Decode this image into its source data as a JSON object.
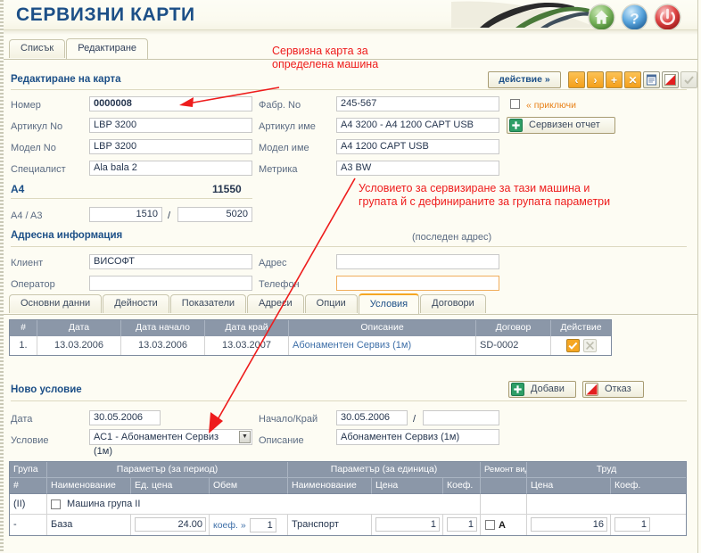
{
  "app": {
    "title": "СЕРВИЗНИ КАРТИ",
    "header_buttons": [
      {
        "name": "home-button",
        "icon": "home-icon",
        "color": "#6aa84f"
      },
      {
        "name": "help-button",
        "icon": "question-mark-icon",
        "color": "#3d85c8"
      },
      {
        "name": "power-button",
        "icon": "power-icon",
        "color": "#cc2b2b"
      }
    ]
  },
  "top_tabs": [
    {
      "label": "Списък",
      "active": false
    },
    {
      "label": "Редактиране",
      "active": true
    }
  ],
  "card_section": {
    "title": "Редактиране на карта",
    "action_button": "действие  »",
    "toolbar_icons": [
      {
        "name": "prev-record-button",
        "glyph": "‹"
      },
      {
        "name": "next-record-button",
        "glyph": "›"
      },
      {
        "name": "add-record-button",
        "glyph": "+"
      },
      {
        "name": "delete-record-button",
        "glyph": "✕"
      },
      {
        "name": "print-button",
        "glyph": "print-icon"
      },
      {
        "name": "cancel-button",
        "glyph": "red-triangle-icon"
      },
      {
        "name": "confirm-button",
        "glyph": "check-icon"
      }
    ],
    "fields": {
      "nomer_label": "Номер",
      "nomer_value": "0000008",
      "artikul_no_label": "Артикул No",
      "artikul_no_value": "LBP 3200",
      "model_no_label": "Модел No",
      "model_no_value": "LBP 3200",
      "specialist_label": "Специалист",
      "specialist_value": "Ala bala 2",
      "fabr_no_label": "Фабр. No",
      "fabr_no_value": "245-567",
      "artikul_ime_label": "Артикул име",
      "artikul_ime_value": "A4 3200 - A4 1200 CAPT USB",
      "model_ime_label": "Модел име",
      "model_ime_value": "A4 1200 CAPT USB",
      "metrika_label": "Метрика",
      "metrika_value": "A3 BW"
    },
    "close_checkbox_label": "« приключи",
    "service_report_button": "Сервизен отчет"
  },
  "counters": {
    "a4_label": "A4",
    "a4_total": "11550",
    "ratio_label": "A4 / A3",
    "a4_value": "1510",
    "separator": "/",
    "a3_value": "5020"
  },
  "address_section": {
    "title": "Адресна информация",
    "note": "(последен адрес)",
    "client_label": "Клиент",
    "client_value": "ВИСОФТ",
    "operator_label": "Оператор",
    "operator_value": "",
    "address_label": "Адрес",
    "address_value": "",
    "phone_label": "Телефон",
    "phone_value": ""
  },
  "inner_tabs": [
    {
      "label": "Основни данни",
      "active": false
    },
    {
      "label": "Дейности",
      "active": false
    },
    {
      "label": "Показатели",
      "active": false
    },
    {
      "label": "Адреси",
      "active": false
    },
    {
      "label": "Опции",
      "active": false
    },
    {
      "label": "Условия",
      "active": true
    },
    {
      "label": "Договори",
      "active": false
    }
  ],
  "conditions_grid": {
    "headers": [
      "#",
      "Дата",
      "Дата начало",
      "Дата край",
      "Описание",
      "Договор",
      "Действие"
    ],
    "rows": [
      {
        "num": "1.",
        "date": "13.03.2006",
        "date_start": "13.03.2006",
        "date_end": "13.03.2007",
        "description": "Абонаментен Сервиз (1м)",
        "contract": "SD-0002",
        "actions": [
          "confirm-row-button",
          "delete-row-button"
        ]
      }
    ]
  },
  "new_condition": {
    "title": "Ново условие",
    "add_button": "Добави",
    "cancel_button": "Отказ",
    "date_label": "Дата",
    "date_value": "30.05.2006",
    "range_label": "Начало/Край",
    "range_from": "30.05.2006",
    "range_sep": "/",
    "range_to": "",
    "condition_label": "Условие",
    "condition_value": "АС1 - Абонаментен Сервиз (1м)",
    "description_label": "Описание",
    "description_value": "Абонаментен Сервиз (1м)"
  },
  "params_grid": {
    "group_headers": [
      "Група",
      "Параметър (за период)",
      "Параметър (за единица)",
      "Ремонт вид",
      "Труд"
    ],
    "sub_headers": [
      "#",
      "Наименование",
      "Ед. цена",
      "Обем",
      "Наименование",
      "Цена",
      "Коеф.",
      "Цена",
      "Коеф."
    ],
    "group_row": {
      "group": "(II)",
      "label": "Машина група II"
    },
    "data_row": {
      "group": "-",
      "p_name": "База",
      "p_unit_price": "24.00",
      "p_volume_label": "коеф.  »",
      "p_volume": "1",
      "u_name": "Транспорт",
      "u_price": "1",
      "u_coef": "1",
      "repair_type": "A",
      "labor_price": "16",
      "labor_coef": "1"
    }
  },
  "annotations": [
    {
      "name": "annotation-service-card",
      "line1": "Сервизна карта за",
      "line2": "определена машина"
    },
    {
      "name": "annotation-condition",
      "line1": "Условието за сервизиране за тази машина и",
      "line2": "групата й с дефинираните за групата параметри"
    }
  ],
  "colors": {
    "brand_blue": "#1c4f87",
    "accent_orange": "#f5a623",
    "grid_header": "#8b97a8",
    "annotation_red": "#ee1c1c",
    "page_bg": "#fdfcf3"
  }
}
